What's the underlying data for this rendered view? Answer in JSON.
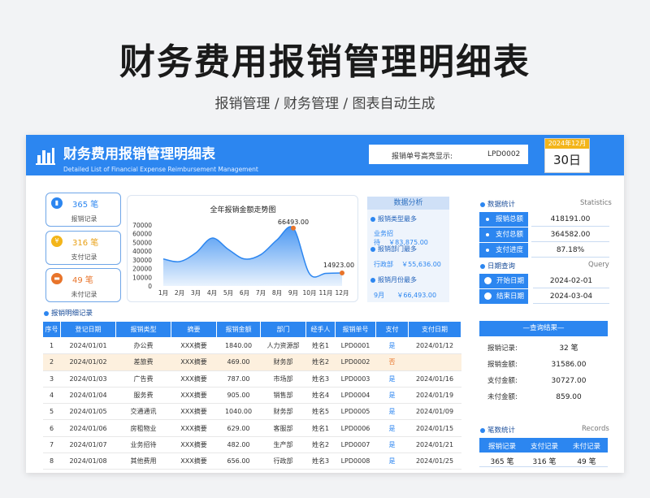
{
  "page": {
    "title": "财务费用报销管理明细表",
    "subtitle": "报销管理 / 财务管理 / 图表自动生成"
  },
  "header": {
    "title": "财务费用报销管理明细表",
    "subtitle_en": "Detailed List of Financial Expense Reimbursement Management",
    "highlight_label": "报销单号高亮显示:",
    "highlight_value": "LPD0002",
    "date_month": "2024年12月",
    "date_day": "30日"
  },
  "cards": [
    {
      "value": "365 笔",
      "label": "报销记录",
      "color": "#2c86f0",
      "value_color": "#2c86f0",
      "icon": "receipt-icon"
    },
    {
      "value": "316 笔",
      "label": "支付记录",
      "color": "#f3b51a",
      "value_color": "#e8a015",
      "icon": "coin-icon"
    },
    {
      "value": "49 笔",
      "label": "未付记录",
      "color": "#e8742a",
      "value_color": "#e8742a",
      "icon": "wallet-icon"
    }
  ],
  "chart_data": {
    "type": "area",
    "title": "全年报销金额走势图",
    "categories": [
      "1月",
      "2月",
      "3月",
      "4月",
      "5月",
      "6月",
      "7月",
      "8月",
      "9月",
      "10月",
      "11月",
      "12月"
    ],
    "values": [
      31000,
      28000,
      38000,
      55000,
      42000,
      31000,
      36000,
      53000,
      66493,
      14000,
      14500,
      14923
    ],
    "ylim": [
      0,
      70000
    ],
    "yticks": [
      "0",
      "10000",
      "20000",
      "30000",
      "40000",
      "50000",
      "60000",
      "70000"
    ],
    "labels": {
      "max": "66493.00",
      "last": "14923.00"
    },
    "colors": {
      "line": "#2c86f0",
      "marker": "#e8742a"
    }
  },
  "analysis": {
    "title": "数据分析",
    "items": [
      {
        "q": "报销类型最多",
        "a_left": "业务招待",
        "a_right": "￥83,875.00"
      },
      {
        "q": "报销部门最多",
        "a_left": "行政部",
        "a_right": "￥55,636.00"
      },
      {
        "q": "报销月份最多",
        "a_left": "9月",
        "a_right": "￥66,493.00"
      }
    ]
  },
  "table": {
    "section": "报销明细记录",
    "headers": [
      "序号",
      "登记日期",
      "报销类型",
      "摘要",
      "报销金额",
      "部门",
      "经手人",
      "报销单号",
      "支付",
      "支付日期"
    ],
    "rows": [
      [
        "1",
        "2024/01/01",
        "办公费",
        "XXX摘要",
        "1840.00",
        "人力资源部",
        "姓名1",
        "LPD0001",
        "是",
        "2024/01/12"
      ],
      [
        "2",
        "2024/01/02",
        "差旅费",
        "XXX摘要",
        "469.00",
        "财务部",
        "姓名2",
        "LPD0002",
        "否",
        ""
      ],
      [
        "3",
        "2024/01/03",
        "广告费",
        "XXX摘要",
        "787.00",
        "市场部",
        "姓名3",
        "LPD0003",
        "是",
        "2024/01/16"
      ],
      [
        "4",
        "2024/01/04",
        "服务费",
        "XXX摘要",
        "905.00",
        "销售部",
        "姓名4",
        "LPD0004",
        "是",
        "2024/01/19"
      ],
      [
        "5",
        "2024/01/05",
        "交通通讯",
        "XXX摘要",
        "1040.00",
        "财务部",
        "姓名5",
        "LPD0005",
        "是",
        "2024/01/09"
      ],
      [
        "6",
        "2024/01/06",
        "房租物业",
        "XXX摘要",
        "629.00",
        "客服部",
        "姓名1",
        "LPD0006",
        "是",
        "2024/01/15"
      ],
      [
        "7",
        "2024/01/07",
        "业务招待",
        "XXX摘要",
        "482.00",
        "生产部",
        "姓名2",
        "LPD0007",
        "是",
        "2024/01/21"
      ],
      [
        "8",
        "2024/01/08",
        "其他费用",
        "XXX摘要",
        "656.00",
        "行政部",
        "姓名3",
        "LPD0008",
        "是",
        "2024/01/25"
      ]
    ],
    "highlight_row": 1
  },
  "stats": {
    "section": "数据统计",
    "section_en": "Statistics",
    "rows": [
      {
        "k": "报销总额",
        "v": "418191.00"
      },
      {
        "k": "支付总额",
        "v": "364582.00"
      },
      {
        "k": "支付进度",
        "v": "87.18%"
      }
    ]
  },
  "query": {
    "section": "日期查询",
    "section_en": "Query",
    "rows": [
      {
        "k": "开始日期",
        "v": "2024-02-01"
      },
      {
        "k": "结束日期",
        "v": "2024-03-04"
      }
    ],
    "result_title": "—查询结果—",
    "results": [
      {
        "k": "报销记录:",
        "v": "32 笔"
      },
      {
        "k": "报销金额:",
        "v": "31586.00"
      },
      {
        "k": "支付金额:",
        "v": "30727.00"
      },
      {
        "k": "未付金额:",
        "v": "859.00"
      }
    ]
  },
  "records": {
    "section": "笔数统计",
    "section_en": "Records",
    "headers": [
      "报销记录",
      "支付记录",
      "未付记录"
    ],
    "values": [
      "365 笔",
      "316 笔",
      "49 笔"
    ]
  }
}
